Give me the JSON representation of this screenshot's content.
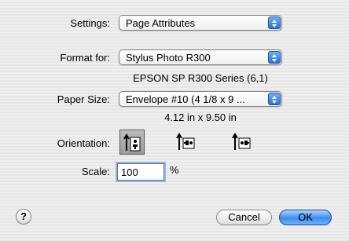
{
  "settings": {
    "label": "Settings:",
    "value": "Page Attributes"
  },
  "format_for": {
    "label": "Format for:",
    "value": "Stylus Photo R300",
    "detail": "EPSON SP R300 Series (6,1)"
  },
  "paper_size": {
    "label": "Paper Size:",
    "value": "Envelope #10 (4 1/8 x 9 ...",
    "dimensions": "4.12 in x 9.50 in"
  },
  "orientation": {
    "label": "Orientation:",
    "options": [
      "portrait",
      "landscape",
      "landscape-reverse"
    ],
    "selected": "portrait"
  },
  "scale": {
    "label": "Scale:",
    "value": "100",
    "unit": "%"
  },
  "buttons": {
    "help": "?",
    "cancel": "Cancel",
    "ok": "OK"
  },
  "colors": {
    "accent": "#3d8cf0",
    "background": "#ececec"
  }
}
